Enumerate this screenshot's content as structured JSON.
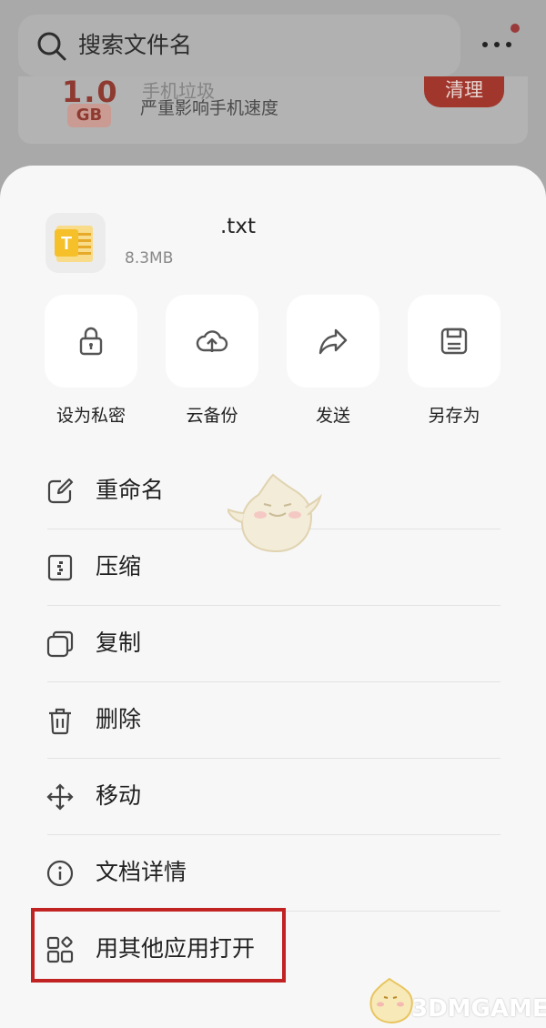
{
  "background": {
    "search_placeholder": "搜索文件名",
    "junk_card": {
      "size": "1.0",
      "unit": "GB",
      "title": "手机垃圾",
      "description": "严重影响手机速度",
      "clean_label": "清理"
    }
  },
  "sheet": {
    "file": {
      "icon_letter": "T",
      "name": ".txt",
      "size": "8.3MB"
    },
    "quick_actions": [
      {
        "label": "设为私密",
        "icon": "lock-icon"
      },
      {
        "label": "云备份",
        "icon": "cloud-upload-icon"
      },
      {
        "label": "发送",
        "icon": "share-arrow-icon"
      },
      {
        "label": "另存为",
        "icon": "save-icon"
      }
    ],
    "menu": [
      {
        "label": "重命名",
        "icon": "edit-icon"
      },
      {
        "label": "压缩",
        "icon": "zip-icon"
      },
      {
        "label": "复制",
        "icon": "copy-icon"
      },
      {
        "label": "删除",
        "icon": "trash-icon"
      },
      {
        "label": "移动",
        "icon": "move-icon"
      },
      {
        "label": "文档详情",
        "icon": "info-icon"
      },
      {
        "label": "用其他应用打开",
        "icon": "apps-icon"
      }
    ]
  },
  "watermark": "3DMGAME",
  "colors": {
    "accent_red": "#c12222",
    "file_icon_yellow": "#f5c02a",
    "sheet_bg": "#f7f7f7",
    "overlay": "#a9a9a9"
  }
}
